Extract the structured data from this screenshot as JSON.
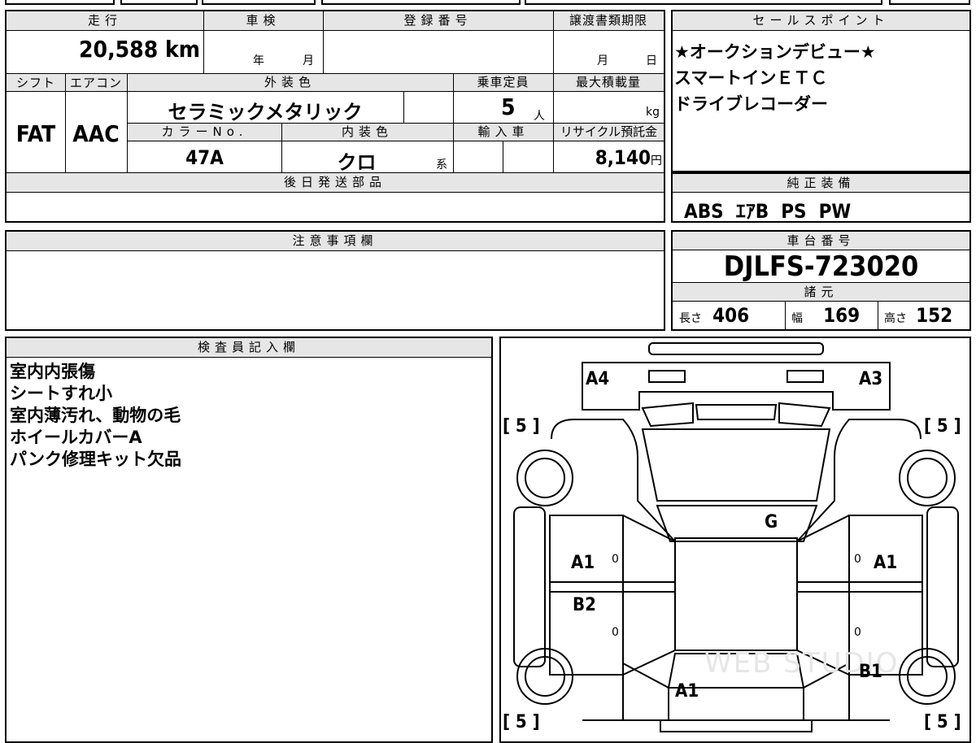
{
  "vehicle": {
    "mileage_label": "走行",
    "mileage_value": "20,588",
    "mileage_unit": "km",
    "shaken_label": "車検",
    "shaken_year": "年",
    "shaken_month": "月",
    "reg_number_label": "登録番号",
    "transfer_deadline_label": "譲渡書類期限",
    "transfer_month": "月",
    "transfer_day": "日",
    "shift_label": "シフト",
    "shift_value": "FAT",
    "ac_label": "エアコン",
    "ac_value": "AAC",
    "exterior_color_label": "外装色",
    "exterior_color_value": "セラミックメタリック",
    "capacity_label": "乗車定員",
    "capacity_value": "5",
    "capacity_unit": "人",
    "max_load_label": "最大積載量",
    "max_load_unit": "kg",
    "color_no_label": "カラーNo.",
    "color_no_value": "47A",
    "interior_color_label": "内装色",
    "interior_color_value": "クロ",
    "interior_color_suffix": "系",
    "import_label": "輸入車",
    "recycle_label": "リサイクル預託金",
    "recycle_value": "8,140",
    "recycle_unit": "円",
    "later_parts_label": "後日発送部品"
  },
  "sales_points": {
    "label": "セールスポイント",
    "items": [
      "★オークションデビュー★",
      "スマートインＥＴＣ",
      "ドライブレコーダー"
    ]
  },
  "equipment": {
    "label": "純正装備",
    "value": "ABS  ｴｱB  PS  PW"
  },
  "notes": {
    "label": "注意事項欄"
  },
  "chassis": {
    "label": "車台番号",
    "value": "DJLFS-723020",
    "spec_label": "諸元",
    "length_label": "長さ",
    "length_value": "406",
    "width_label": "幅",
    "width_value": "169",
    "height_label": "高さ",
    "height_value": "152"
  },
  "inspector": {
    "label": "検査員記入欄",
    "items": [
      "室内内張傷",
      "シートすれ小",
      "室内薄汚れ、動物の毛",
      "ホイールカバーA",
      "パンク修理キット欠品"
    ]
  },
  "diagram": {
    "marks": {
      "front_left": "A4",
      "front_right": "A3",
      "windshield": "G",
      "left_front_door": "A1",
      "left_rear_door": "B2",
      "right_front_door": "A1",
      "right_rear_quarter": "B1",
      "rear": "A1"
    },
    "tire_depths": [
      "[ 5 ]",
      "[ 5 ]",
      "[ 5 ]",
      "[ 5 ]"
    ],
    "door_marks": [
      "0",
      "0",
      "0",
      "0"
    ],
    "watermark": "WEB STUDIO"
  }
}
